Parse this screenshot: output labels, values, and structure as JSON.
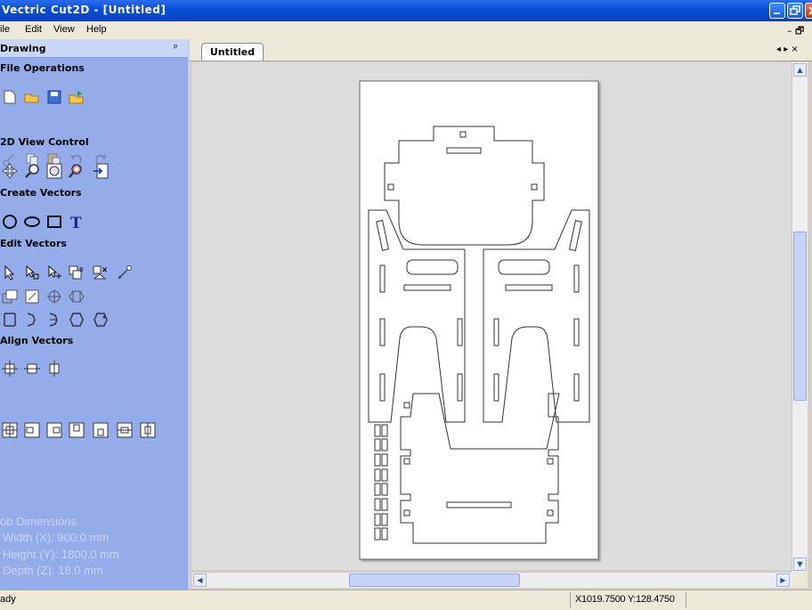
{
  "window": {
    "title": "Vectric Cut2D - [Untitled]"
  },
  "menu": {
    "items": [
      "ile",
      "Edit",
      "View",
      "Help"
    ],
    "doc_controls": "– 🗗"
  },
  "panel": {
    "title": "Drawing",
    "pin": "ᵖ",
    "sections": {
      "file_operations": "File Operations",
      "view_control": "2D View Control",
      "create_vectors": "Create Vectors",
      "edit_vectors": "Edit Vectors",
      "align_vectors": "Align Vectors"
    },
    "job_dimensions": {
      "heading": "ob Dimensions",
      "width": "Width  (X): 900.0 mm",
      "height": "Height (Y): 1800.0 mm",
      "depth": "Depth  (Z): 18.0 mm"
    }
  },
  "tabs": {
    "active": "Untitled",
    "controls": "◂ ▸ ×"
  },
  "statusbar": {
    "status": "ady",
    "coords": "X1019.7500 Y:128.4750"
  },
  "colors": {
    "panel_bg": "#95acea",
    "titlebar": "#0a4fd8",
    "canvas_bg": "#dcdcdc"
  }
}
